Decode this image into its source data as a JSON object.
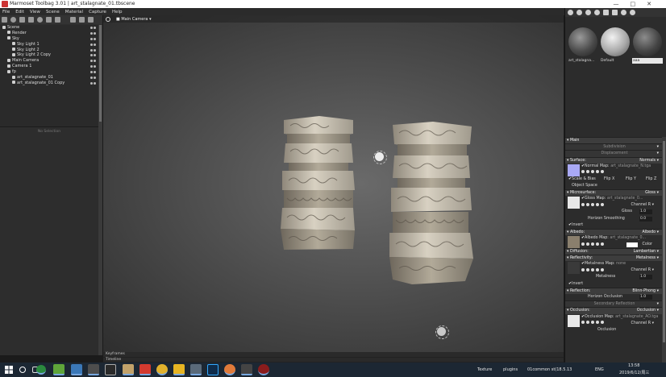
{
  "window": {
    "title": "Marmoset Toolbag 3.01  |  art_stalagnate_01.tbscene"
  },
  "menu": [
    "File",
    "Edit",
    "View",
    "Scene",
    "Material",
    "Capture",
    "Help"
  ],
  "outliner": {
    "items": [
      {
        "label": "Scene",
        "icon": "scene-icon"
      },
      {
        "label": "Render",
        "icon": "render-icon"
      },
      {
        "label": "Sky",
        "icon": "sky-icon"
      },
      {
        "label": "Sky Light 1",
        "icon": "light-icon"
      },
      {
        "label": "Sky Light 2",
        "icon": "light-icon"
      },
      {
        "label": "Sky Light 2 Copy",
        "icon": "light-icon"
      },
      {
        "label": "Main Camera",
        "icon": "camera-icon"
      },
      {
        "label": "Camera 1",
        "icon": "camera-icon"
      },
      {
        "label": "fp",
        "icon": "group-icon"
      },
      {
        "label": "art_stalagnate_01",
        "icon": "mesh-icon"
      },
      {
        "label": "art_stalagnate_01 Copy",
        "icon": "mesh-icon"
      }
    ],
    "no_selection": "No Selection"
  },
  "viewport": {
    "camera_label": "Main Camera"
  },
  "timeline": {
    "keyframes": "Keyframes",
    "timeline": "Timeline"
  },
  "materials": {
    "items": [
      {
        "label": "art_stalagna..."
      },
      {
        "label": "Default"
      },
      {
        "label": "aaa"
      }
    ]
  },
  "properties": {
    "main": "Main",
    "subdivision": "Subdivision",
    "displacement": "Displacement",
    "surface": {
      "label": "Surface:",
      "value": "Normals"
    },
    "normal_map": "Normal Map:",
    "normal_map_file": "art_stalagnate_N.tga",
    "scale_bias": "Scale & Bias",
    "flip_x": "Flip X",
    "flip_y": "Flip Y",
    "flip_z": "Flip Z",
    "object_space": "Object Space",
    "microsurface": {
      "label": "Microsurface:",
      "value": "Gloss"
    },
    "gloss_map": "Gloss Map:",
    "gloss_map_file": "art_stalagnate_0...",
    "channel": "Channel",
    "channel_value": "R",
    "gloss": "Gloss",
    "gloss_value": "1.0",
    "horizon_smoothing": "Horizon Smoothing",
    "horizon_smoothing_value": "0.0",
    "invert": "Invert",
    "albedo": {
      "label": "Albedo:",
      "value": "Albedo"
    },
    "albedo_map": "Albedo Map:",
    "albedo_map_file": "art_stalagnate_0...",
    "color": "Color",
    "diffusion": {
      "label": "Diffusion:",
      "value": "Lambertian"
    },
    "reflectivity": {
      "label": "Reflectivity:",
      "value": "Metalness"
    },
    "metalness_map": "Metalness Map:",
    "metalness_map_file": "none",
    "metalness": "Metalness",
    "metalness_value": "1.0",
    "invert2": "Invert",
    "reflection": {
      "label": "Reflection:",
      "value": "Blinn-Phong"
    },
    "horizon_occlusion": "Horizon Occlusion",
    "horizon_occlusion_value": "1.0",
    "secondary_reflection": "Secondary Reflection",
    "occlusion": {
      "label": "Occlusion:",
      "value": "Occlusion"
    },
    "occlusion_map": "Occlusion Map:",
    "occlusion_map_file": "art_stalagnate_AO.tga",
    "occlusion_label": "Occlusion"
  },
  "taskbar": {
    "texture": "Texture",
    "plugins": "plugins",
    "file": "01common st(18.5.13",
    "lang": "ENG",
    "time": "13:58",
    "date": "2019/6/12/周三"
  },
  "colors": {
    "accent": "#3b4f6b",
    "selected_matball": "#e8e8e8"
  }
}
